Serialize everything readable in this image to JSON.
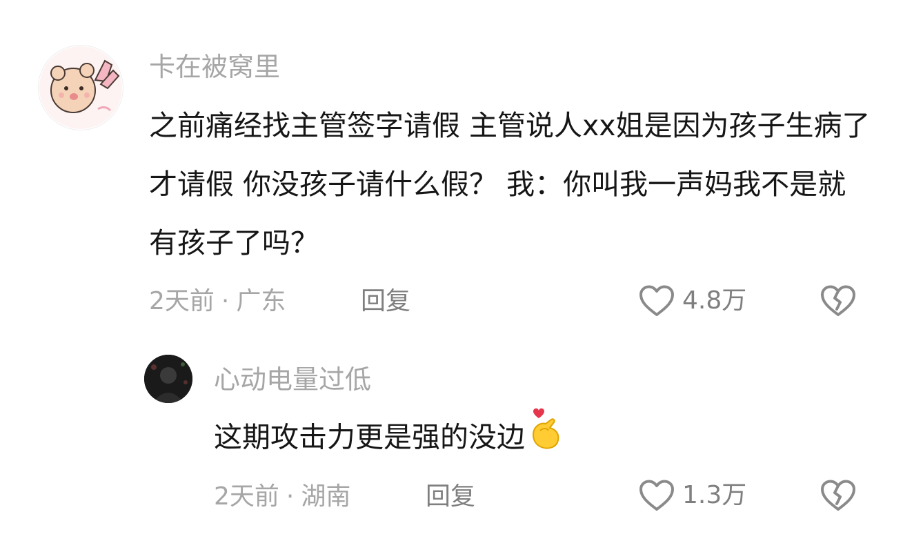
{
  "comments": [
    {
      "author": "卡在被窝里",
      "text": "之前痛经找主管签字请假 主管说人xx姐是因为孩子生病了才请假 你没孩子请什么假？ 我：你叫我一声妈我不是就有孩子了吗？",
      "time": "2天前",
      "location": "广东",
      "reply_label": "回复",
      "likes": "4.8万",
      "avatar_icon": "cartoon-bear-avatar"
    },
    {
      "author": "心动电量过低",
      "text": "这期攻击力更是强的没边",
      "emoji": "finger-heart-emoji",
      "time": "2天前",
      "location": "湖南",
      "reply_label": "回复",
      "likes": "1.3万",
      "avatar_icon": "dark-photo-avatar"
    }
  ],
  "meta_separator": "·",
  "colors": {
    "muted": "#a6a6a6",
    "body": "#161616",
    "icon": "#7f7f7f"
  }
}
